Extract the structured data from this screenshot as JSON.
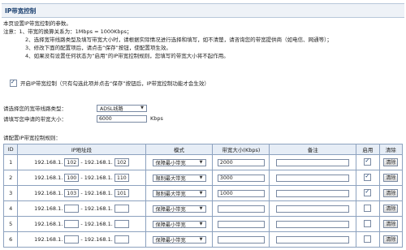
{
  "page": {
    "title": "IP带宽控制"
  },
  "notes": {
    "intro": "本页设置IP带宽控制的参数。",
    "lines": [
      "注意：1、带宽的换算关系为：1Mbps = 1000Kbps；",
      "2、选择宽带线路类型及填写带宽大小时，请根据实际情况进行选择和填写，如不清楚，请咨询您的带宽提供商（如电信、网通等）；",
      "3、修改下面的配置项后，请点击“保存”按钮，使配置项生效。",
      "4、如果没有设置任何状态为“启用”的IP带宽控制规则，您填写的带宽大小将不起作用。"
    ]
  },
  "enable": {
    "checked": true,
    "label": "开启IP带宽控制（只有勾选此项并点击“保存”按钮后，IP带宽控制功能才会生效）"
  },
  "line_type": {
    "label": "请选择您的宽带线路类型：",
    "value": "ADSL线路"
  },
  "bandwidth": {
    "label": "请填写您申请的带宽大小：",
    "value": "6000",
    "unit": "Kbps"
  },
  "rules_label": "请配置IP带宽控制规则：",
  "table": {
    "headers": [
      "ID",
      "IP地址段",
      "模式",
      "带宽大小(Kbps)",
      "备注",
      "启用",
      "清除"
    ],
    "ip_prefix": "192.168.1.",
    "rows": [
      {
        "id": "1",
        "ip_start": "102",
        "ip_end": "102",
        "mode": "保障最小带宽",
        "bandwidth": "2000",
        "note": "",
        "enabled": true,
        "clear": "清除"
      },
      {
        "id": "2",
        "ip_start": "100",
        "ip_end": "110",
        "mode": "限制最大带宽",
        "bandwidth": "3000",
        "note": "",
        "enabled": true,
        "clear": "清除"
      },
      {
        "id": "3",
        "ip_start": "103",
        "ip_end": "101",
        "mode": "限制最大带宽",
        "bandwidth": "1000",
        "note": "",
        "enabled": true,
        "clear": "清除"
      },
      {
        "id": "4",
        "ip_start": "",
        "ip_end": "",
        "mode": "保障最小带宽",
        "bandwidth": "",
        "note": "",
        "enabled": false,
        "clear": "清除"
      },
      {
        "id": "5",
        "ip_start": "",
        "ip_end": "",
        "mode": "保障最小带宽",
        "bandwidth": "",
        "note": "",
        "enabled": false,
        "clear": "清除"
      },
      {
        "id": "6",
        "ip_start": "",
        "ip_end": "",
        "mode": "保障最小带宽",
        "bandwidth": "",
        "note": "",
        "enabled": false,
        "clear": "清除"
      }
    ]
  }
}
